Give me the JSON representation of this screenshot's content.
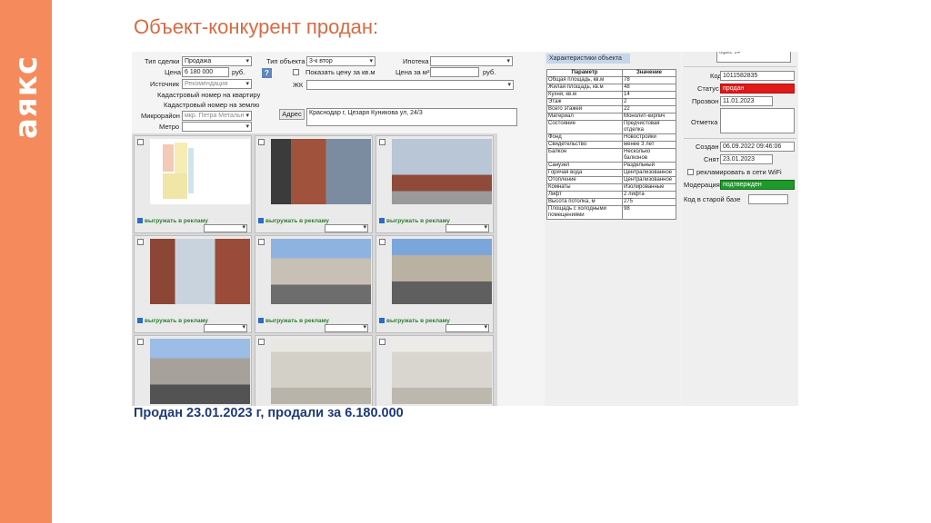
{
  "slide": {
    "brand": "аякс",
    "title": "Объект-конкурент продан:",
    "caption": "Продан 23.01.2023 г, продали за 6.180.000"
  },
  "form": {
    "deal_type_label": "Тип сделки",
    "deal_type_value": "Продажа",
    "price_label": "Цена",
    "price_value": "6 180 000",
    "price_unit": "руб.",
    "source_label": "Источник",
    "source_value": "Рекомендация",
    "cadastral_flat_label": "Кадастровый номер на квартиру",
    "cadastral_land_label": "Кадастровый номер на землю",
    "district_label": "Микрорайон",
    "district_value": "мкр. Петра Метальн",
    "metro_label": "Метро",
    "metro_value": "",
    "object_type_label": "Тип объекта",
    "object_type_value": "3-к втор",
    "help_label": "?",
    "show_price_label": "Показать цену за кв.м",
    "complex_label": "ЖК",
    "mortgage_label": "Ипотека",
    "price_per_m2_label": "Цена за м²",
    "price_per_m2_unit": "руб.",
    "address_button": "Адрес",
    "address_value": "Краснодар г, Цезаря Куникова ул, 24/3"
  },
  "photos": {
    "export_label": "выгружать в рекламу",
    "items": [
      {
        "kind": "plan"
      },
      {
        "kind": "brick"
      },
      {
        "kind": "balcony"
      },
      {
        "kind": "loggia"
      },
      {
        "kind": "street1"
      },
      {
        "kind": "street2"
      },
      {
        "kind": "street3"
      },
      {
        "kind": "room1"
      },
      {
        "kind": "room2"
      }
    ]
  },
  "characteristics": {
    "header": "Характеристики объекта",
    "col_param": "Параметр",
    "col_value": "Значение",
    "rows": [
      {
        "p": "Общая площадь, кв.м",
        "v": "78"
      },
      {
        "p": "Жилая площадь, кв.м",
        "v": "48"
      },
      {
        "p": "Кухня, кв.м",
        "v": "14"
      },
      {
        "p": "Этаж",
        "v": "2"
      },
      {
        "p": "Всего этажей",
        "v": "22"
      },
      {
        "p": "Материал",
        "v": "Монолит-кирпич"
      },
      {
        "p": "Состояние",
        "v": "Предчистовая отделка"
      },
      {
        "p": "Фонд",
        "v": "Новостройки"
      },
      {
        "p": "Свидетельство",
        "v": "менее 3 лет"
      },
      {
        "p": "Балкон",
        "v": "Несколько балконов"
      },
      {
        "p": "Санузел",
        "v": "Раздельный"
      },
      {
        "p": "Горячая вода",
        "v": "Централизованное"
      },
      {
        "p": "Отопление",
        "v": "Централизованное"
      },
      {
        "p": "Комнаты",
        "v": "Изолированные"
      },
      {
        "p": "Лифт",
        "v": "2 лифта"
      },
      {
        "p": "Высота потолка, м",
        "v": "275"
      },
      {
        "p": "Площадь с холодными помещениями",
        "v": "98"
      }
    ]
  },
  "details": {
    "top_note": "офис 14",
    "code_label": "Код",
    "code_value": "1011582835",
    "status_label": "Статус",
    "status_value": "продан",
    "call_label": "Прозвон",
    "call_value": "11.01.2023",
    "note_label": "Отметка",
    "created_label": "Создан",
    "created_value": "06.09.2022 09:46:06",
    "removed_label": "Снят",
    "removed_value": "23.01.2023",
    "wifi_label": "рекламировать в сети WiFi",
    "moderation_label": "Модерация",
    "moderation_value": "подтвержден",
    "old_code_label": "Код в старой базе"
  },
  "colors": {
    "brand_orange": "#f58b5c",
    "title_orange": "#d96a41",
    "caption_blue": "#1f3a7a",
    "status_red": "#e01919",
    "moderation_green": "#1e9a2a"
  }
}
